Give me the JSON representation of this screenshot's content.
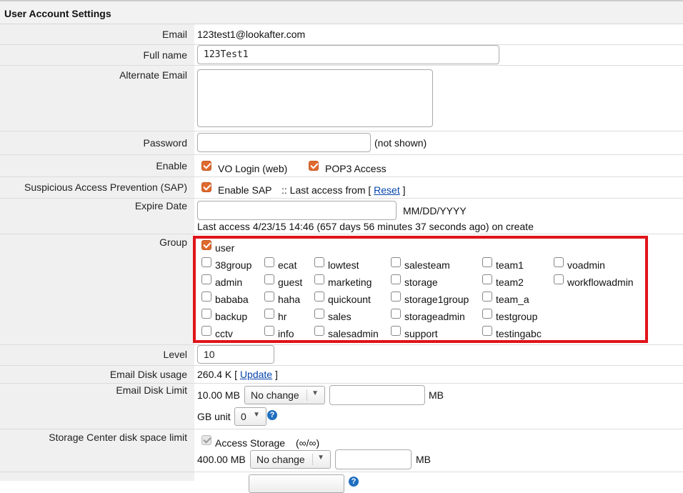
{
  "header": {
    "title": "User Account Settings"
  },
  "email": {
    "label": "Email",
    "value": "123test1@lookafter.com"
  },
  "fullname": {
    "label": "Full name",
    "value": "123Test1"
  },
  "alt_email": {
    "label": "Alternate Email",
    "value": ""
  },
  "password": {
    "label": "Password",
    "value": "",
    "note": "(not shown)"
  },
  "enable": {
    "label": "Enable",
    "vo_login": "VO Login (web)",
    "pop3": "POP3 Access"
  },
  "sap": {
    "label": "Suspicious Access Prevention (SAP)",
    "enable": "Enable SAP",
    "last_access_prefix": ":: Last access from [",
    "reset": "Reset",
    "suffix": "]"
  },
  "expire": {
    "label": "Expire Date",
    "value": "",
    "format": "MM/DD/YYYY",
    "last_access": "Last access 4/23/15 14:46 (657 days 56 minutes 37 seconds ago) on create"
  },
  "group": {
    "label": "Group",
    "user": "user",
    "col1": [
      "38group",
      "admin",
      "bababa",
      "backup",
      "cctv"
    ],
    "col2": [
      "ecat",
      "guest",
      "haha",
      "hr",
      "info"
    ],
    "col3": [
      "lowtest",
      "marketing",
      "quickount",
      "sales",
      "salesadmin"
    ],
    "col4": [
      "salesteam",
      "storage",
      "storage1group",
      "storageadmin",
      "support"
    ],
    "col5": [
      "team1",
      "team2",
      "team_a",
      "testgroup",
      "testingabc"
    ],
    "col6": [
      "voadmin",
      "workflowadmin"
    ]
  },
  "level": {
    "label": "Level",
    "value": "10"
  },
  "disk_usage": {
    "label": "Email Disk usage",
    "value": "260.4 K [",
    "update": "Update",
    "suffix": "]"
  },
  "disk_limit": {
    "label": "Email Disk Limit",
    "value": "10.00 MB",
    "select": "No change",
    "unit": "MB",
    "gb_unit_label": "GB unit",
    "gb_unit_value": "0"
  },
  "storage": {
    "label": "Storage Center disk space limit",
    "access": "Access Storage",
    "infinity": "(∞/∞)",
    "value": "400.00 MB",
    "select": "No change",
    "unit": "MB"
  },
  "colors": {
    "accent": "#e06a2e",
    "highlight": "#e0141a",
    "link": "#0645ad"
  }
}
